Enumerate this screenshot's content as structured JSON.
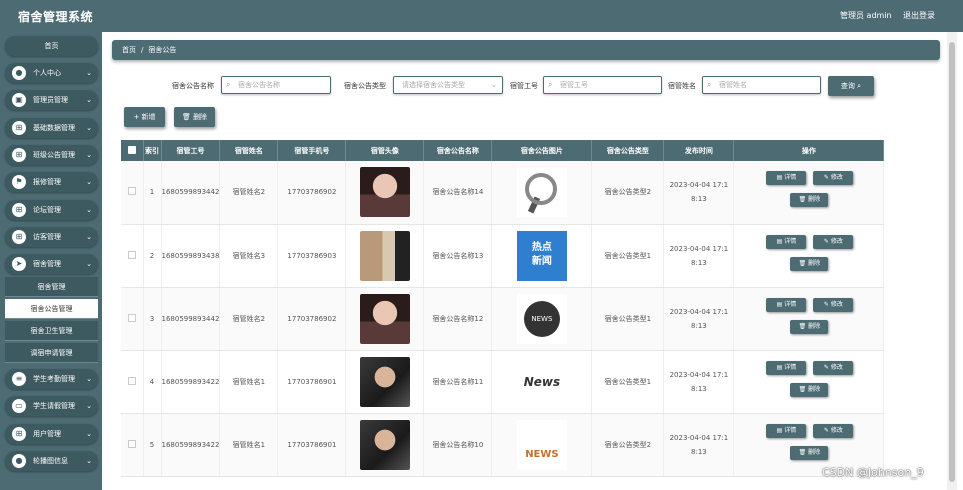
{
  "app": {
    "title": "宿舍管理系统",
    "user": "管理员 admin",
    "logout": "退出登录"
  },
  "sidebar": {
    "home": "首页",
    "items": [
      {
        "label": "个人中心",
        "icon": "person-icon"
      },
      {
        "label": "管理员管理",
        "icon": "admin-icon"
      },
      {
        "label": "基础数据管理",
        "icon": "grid-icon"
      },
      {
        "label": "班级公告管理",
        "icon": "grid-icon"
      },
      {
        "label": "报修管理",
        "icon": "flag-icon"
      },
      {
        "label": "论坛管理",
        "icon": "grid-icon"
      },
      {
        "label": "访客管理",
        "icon": "grid-icon"
      },
      {
        "label": "宿舍管理",
        "icon": "send-icon"
      }
    ],
    "subitems": [
      "宿舍管理",
      "宿舍公告管理",
      "宿舍卫生管理",
      "调宿申请管理"
    ],
    "items2": [
      {
        "label": "学生考勤管理",
        "icon": "list-icon"
      },
      {
        "label": "学生请假管理",
        "icon": "monitor-icon"
      },
      {
        "label": "用户管理",
        "icon": "grid-icon"
      },
      {
        "label": "轮播图信息",
        "icon": "person-icon"
      }
    ]
  },
  "breadcrumb": {
    "home": "首页",
    "separator": "/",
    "current": "宿舍公告"
  },
  "search": {
    "name_label": "宿舍公告名称",
    "name_placeholder": "宿舍公告名称",
    "type_label": "宿舍公告类型",
    "type_placeholder": "请选择宿舍公告类型",
    "worker_label": "宿管工号",
    "worker_placeholder": "宿管工号",
    "staff_label": "宿管姓名",
    "staff_placeholder": "宿管姓名",
    "query_button": "查询"
  },
  "actions": {
    "add": "+ 新增",
    "delete": "删除"
  },
  "table": {
    "headers": [
      "索引",
      "宿管工号",
      "宿管姓名",
      "宿管手机号",
      "宿管头像",
      "宿舍公告名称",
      "宿舍公告图片",
      "宿舍公告类型",
      "发布时间",
      "操作"
    ],
    "rows": [
      {
        "index": "1",
        "worker_id": "1680599893442",
        "name": "宿管姓名2",
        "phone": "17703786902",
        "avatar": "girl",
        "title": "宿舍公告名称14",
        "image": "magnifier-news",
        "type": "宿舍公告类型2",
        "time": "2023-04-04 17:18:13"
      },
      {
        "index": "2",
        "worker_id": "1680599893438",
        "name": "宿管姓名3",
        "phone": "17703786903",
        "avatar": "room",
        "title": "宿舍公告名称13",
        "image": "hot-news",
        "type": "宿舍公告类型1",
        "time": "2023-04-04 17:18:13"
      },
      {
        "index": "3",
        "worker_id": "1680599893442",
        "name": "宿管姓名2",
        "phone": "17703786902",
        "avatar": "girl",
        "title": "宿舍公告名称12",
        "image": "globe-news",
        "type": "宿舍公告类型1",
        "time": "2023-04-04 17:18:13"
      },
      {
        "index": "4",
        "worker_id": "1680599893422",
        "name": "宿管姓名1",
        "phone": "17703786901",
        "avatar": "man",
        "title": "宿舍公告名称11",
        "image": "newspaper",
        "type": "宿舍公告类型1",
        "time": "2023-04-04 17:18:13"
      },
      {
        "index": "5",
        "worker_id": "1680599893422",
        "name": "宿管姓名1",
        "phone": "17703786901",
        "avatar": "man",
        "title": "宿舍公告名称10",
        "image": "3d-news",
        "type": "宿舍公告类型2",
        "time": "2023-04-04 17:18:13"
      }
    ],
    "op_detail": "详情",
    "op_edit": "修改",
    "op_delete": "删除",
    "image_texts": {
      "hot-news": "热点\n新闻",
      "newspaper": "News",
      "3d-news": "NEWS"
    }
  },
  "watermark": "CSDN @Johnson_9"
}
